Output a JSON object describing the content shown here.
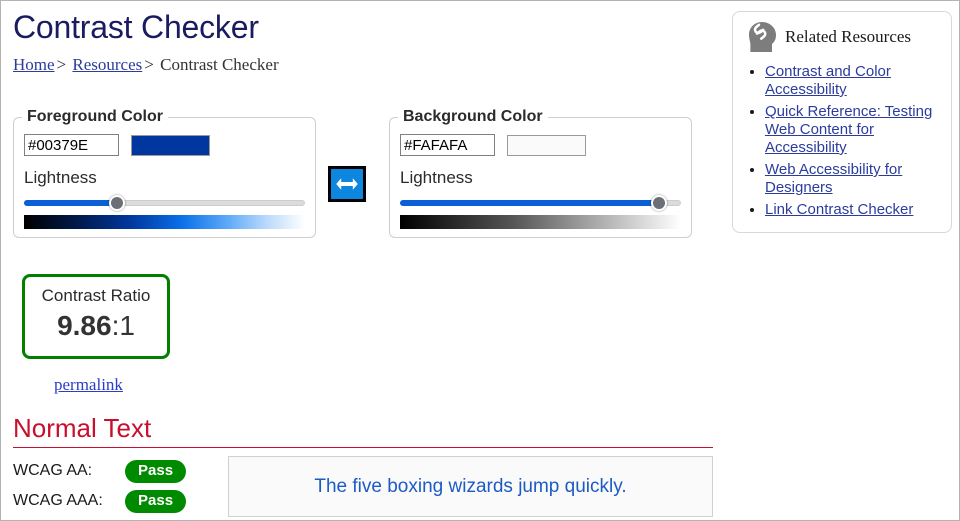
{
  "page": {
    "title": "Contrast Checker"
  },
  "breadcrumb": {
    "home": "Home",
    "sep1": ">",
    "resources": "Resources",
    "sep2": ">",
    "current": "Contrast Checker"
  },
  "foreground": {
    "legend": "Foreground Color",
    "hex_value": "#00379E",
    "hex_placeholder": "#000000",
    "swatch_color": "#00379E",
    "lightness_label": "Lightness",
    "lightness_percent": 33
  },
  "background": {
    "legend": "Background Color",
    "hex_value": "#FAFAFA",
    "hex_placeholder": "#FFFFFF",
    "swatch_color": "#FAFAFA",
    "lightness_label": "Lightness",
    "lightness_percent": 92
  },
  "swap": {
    "icon": "swap-horizontal-icon",
    "accent_color": "#0D86E0"
  },
  "contrast": {
    "label": "Contrast Ratio",
    "value": "9.86",
    "suffix": ":1",
    "status_color": "#018000",
    "permalink_label": "permalink"
  },
  "normal_text": {
    "heading": "Normal Text",
    "heading_color": "#C8102E",
    "criteria": [
      {
        "label": "WCAG AA:",
        "result": "Pass",
        "result_color": "#008A00"
      },
      {
        "label": "WCAG AAA:",
        "result": "Pass",
        "result_color": "#008A00"
      }
    ],
    "sample_text": "The five boxing wizards jump quickly.",
    "sample_text_color": "#1D5BC4",
    "sample_bg_color": "#FAFAFA"
  },
  "sidebar": {
    "icon": "link-head-icon",
    "title": "Related Resources",
    "links": [
      "Contrast and Color Accessibility",
      "Quick Reference: Testing Web Content for Accessibility",
      "Web Accessibility for Designers",
      "Link Contrast Checker"
    ]
  }
}
